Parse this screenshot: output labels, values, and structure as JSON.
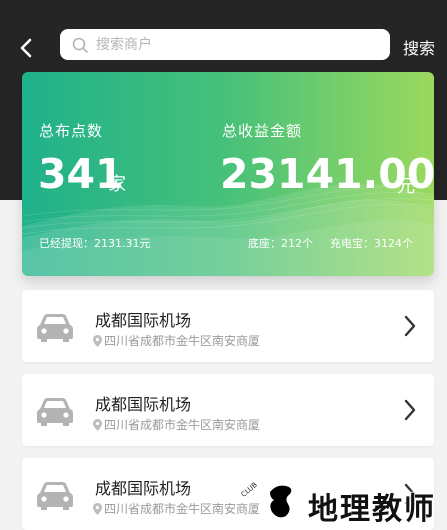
{
  "search": {
    "placeholder": "搜索商户",
    "button_label": "搜索"
  },
  "stats": {
    "points_label": "总布点数",
    "points_value": "341",
    "points_unit": "家",
    "income_label": "总收益金额",
    "income_value": "23141.00",
    "income_unit": "元",
    "withdrawn": "已经提现：2131.31元",
    "bases": "底座：212个",
    "power_banks": "充电宝：3124个"
  },
  "merchants": [
    {
      "name": "成都国际机场",
      "address": "四川省成都市金牛区南安商厦"
    },
    {
      "name": "成都国际机场",
      "address": "四川省成都市金牛区南安商厦"
    },
    {
      "name": "成都国际机场",
      "address": "四川省成都市金牛区南安商厦"
    }
  ],
  "watermark": {
    "text": "地理教师"
  },
  "colors": {
    "header_bg": "#252525",
    "card_gradient_start": "#1fb18a",
    "card_gradient_end": "#9bd95e",
    "icon_gray": "#b3b3b3"
  }
}
